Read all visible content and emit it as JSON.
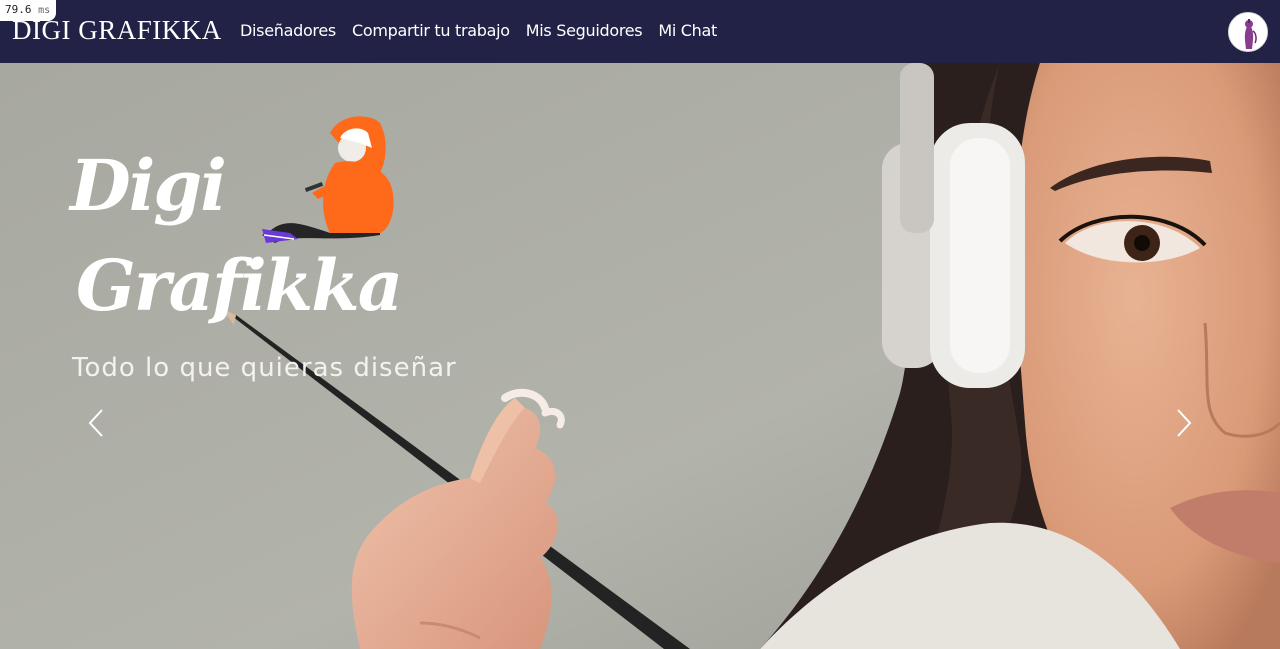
{
  "timing": {
    "value": "79.6",
    "unit": "ms"
  },
  "navbar": {
    "brand": "DIGI GRAFIKKA",
    "links": [
      "Diseñadores",
      "Compartir tu trabajo",
      "Mis Seguidores",
      "Mi Chat"
    ],
    "avatar_icon": "profile-avatar"
  },
  "hero": {
    "logo_line1": "Digi",
    "logo_line2": "Grafikka",
    "tagline": "Todo lo que quieras diseñar",
    "prev_icon": "chevron-left-icon",
    "next_icon": "chevron-right-icon"
  },
  "colors": {
    "navbar": "#212246",
    "hero_bg": "#a9aba2",
    "hoodie": "#ff6a1a"
  }
}
